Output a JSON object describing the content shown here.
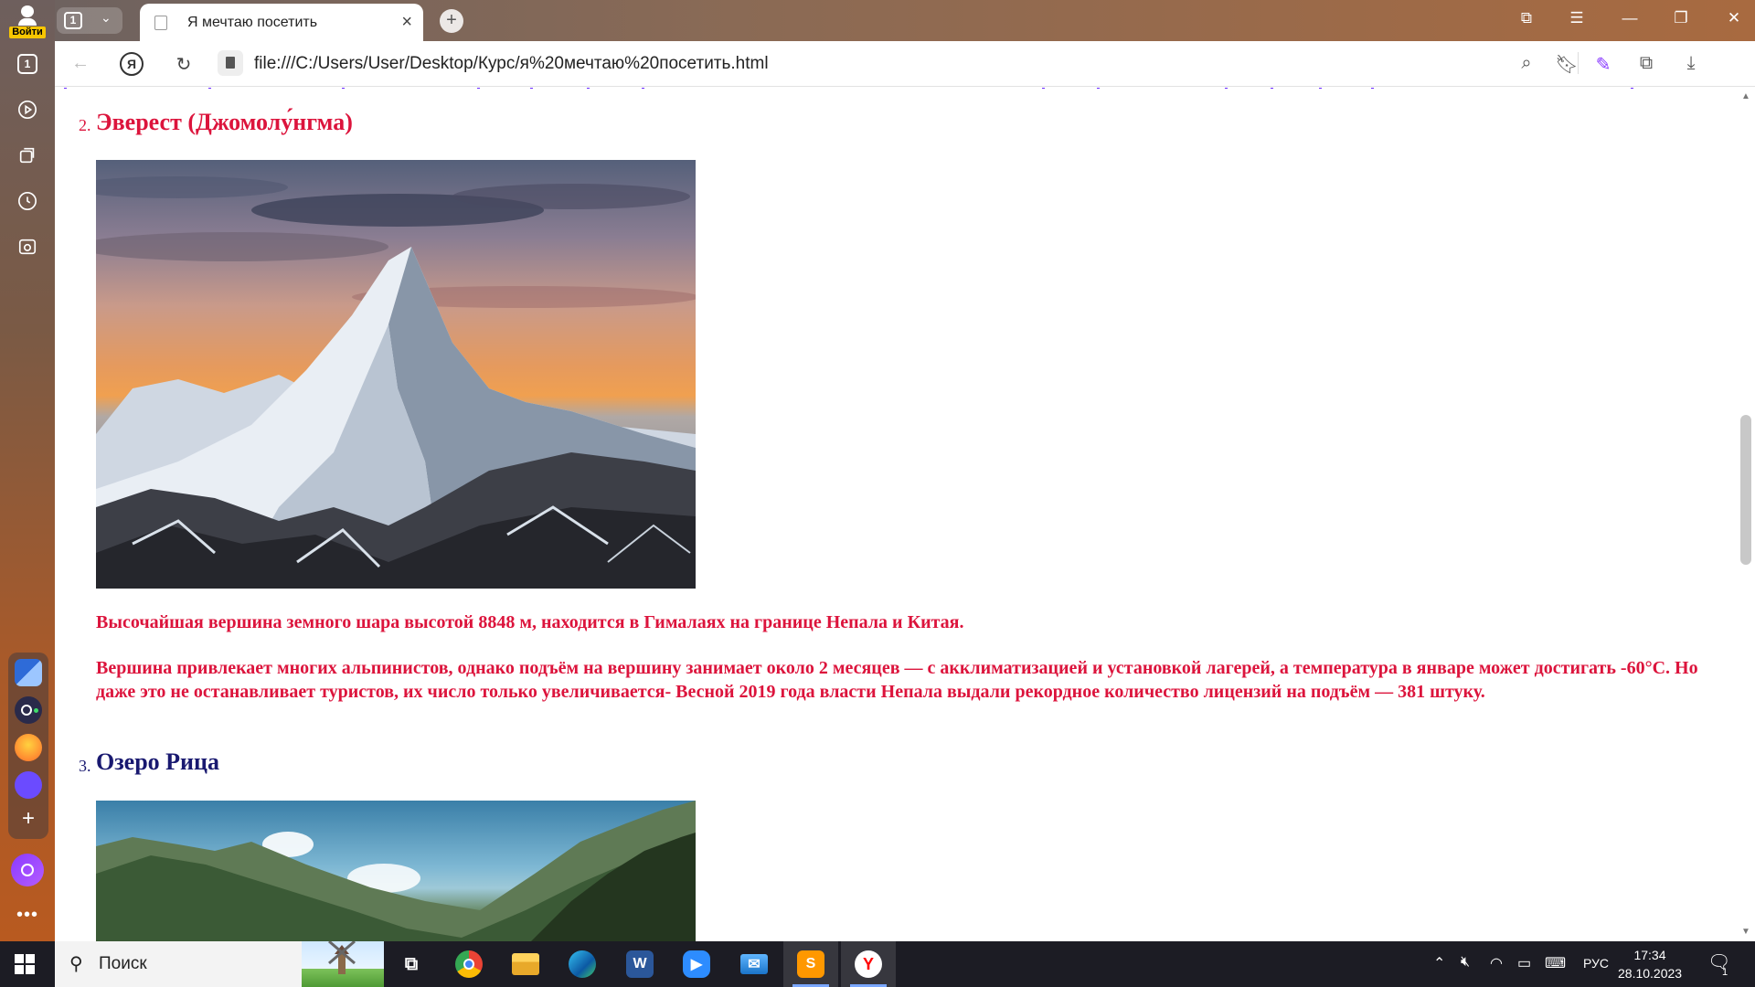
{
  "sidebar": {
    "login_label": "Войти",
    "items": [
      {
        "name": "tabs-counter",
        "label": "1"
      },
      {
        "name": "play-icon"
      },
      {
        "name": "collections-icon"
      },
      {
        "name": "history-icon"
      },
      {
        "name": "screenshot-icon"
      }
    ]
  },
  "browser": {
    "tab_counter": "1",
    "active_tab_title": "Я мечтаю посетить",
    "url": "file:///C:/Users/User/Desktop/Курс/я%20мечтаю%20посетить.html",
    "yandex_button": "Я"
  },
  "page": {
    "destinations": [
      {
        "number": "2.",
        "title": "Эверест (Джомолу́нгма)",
        "title_color": "#dc143c",
        "paragraphs": [
          "Высочайшая вершина земного шара высотой 8848 м, находится в Гималаях на границе Непала и Китая.",
          "Вершина привлекает многих альпинистов, однако подъём на вершину занимает около 2 месяцев — с акклиматизацией и установкой лагерей, а температура в январе может достигать -60°C. Но даже это не останавливает туристов, их число только увеличивается- Весной 2019 года власти Непала выдали рекордное количество лицензий на подъём — 381 штуку."
        ]
      },
      {
        "number": "3.",
        "title": "Озеро Рица",
        "title_color": "#191970"
      }
    ]
  },
  "taskbar": {
    "search_placeholder": "Поиск",
    "apps": [
      "task-view",
      "chrome",
      "file-explorer",
      "edge",
      "word",
      "zoom",
      "mail",
      "sublime-text",
      "yandex-browser"
    ],
    "language": "РУС",
    "time": "17:34",
    "date": "28.10.2023",
    "notification_count": "1"
  },
  "colors": {
    "accent_red": "#dc143c",
    "title_navy": "#191970",
    "link_purple": "#6a2aff"
  }
}
